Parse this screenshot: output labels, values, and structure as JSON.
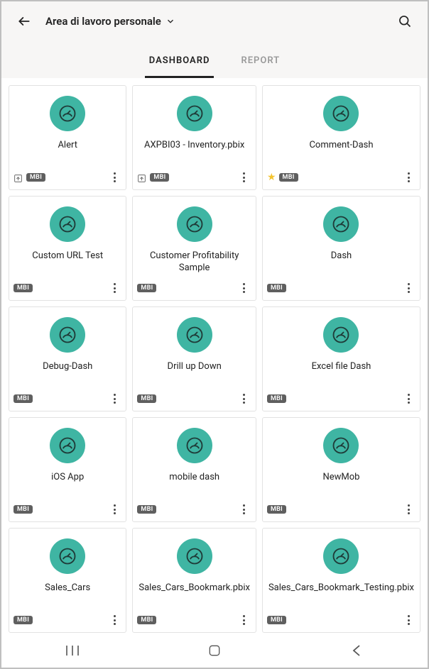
{
  "header": {
    "title": "Area di lavoro personale"
  },
  "tabs": {
    "dashboard": "DASHBOARD",
    "report": "REPORT",
    "activeIndex": 0
  },
  "badge": "MBI",
  "cards": [
    {
      "title": "Alert",
      "share": true,
      "star": false
    },
    {
      "title": "AXPBI03 - Inventory.pbix",
      "share": true,
      "star": false
    },
    {
      "title": "Comment-Dash",
      "share": false,
      "star": true
    },
    {
      "title": "Custom URL Test",
      "share": false,
      "star": false
    },
    {
      "title": "Customer Profitability Sample",
      "share": false,
      "star": false
    },
    {
      "title": "Dash",
      "share": false,
      "star": false
    },
    {
      "title": "Debug-Dash",
      "share": false,
      "star": false
    },
    {
      "title": "Drill up Down",
      "share": false,
      "star": false
    },
    {
      "title": "Excel file Dash",
      "share": false,
      "star": false
    },
    {
      "title": "iOS App",
      "share": false,
      "star": false
    },
    {
      "title": "mobile dash",
      "share": false,
      "star": false
    },
    {
      "title": "NewMob",
      "share": false,
      "star": false
    },
    {
      "title": "Sales_Cars",
      "share": false,
      "star": false
    },
    {
      "title": "Sales_Cars_Bookmark.pbix",
      "share": false,
      "star": false
    },
    {
      "title": "Sales_Cars_Bookmark_Testing.pbix",
      "share": false,
      "star": false
    },
    {
      "title": "",
      "cut": true
    },
    {
      "title": "",
      "cut": true
    },
    {
      "title": "",
      "cut": true
    }
  ]
}
